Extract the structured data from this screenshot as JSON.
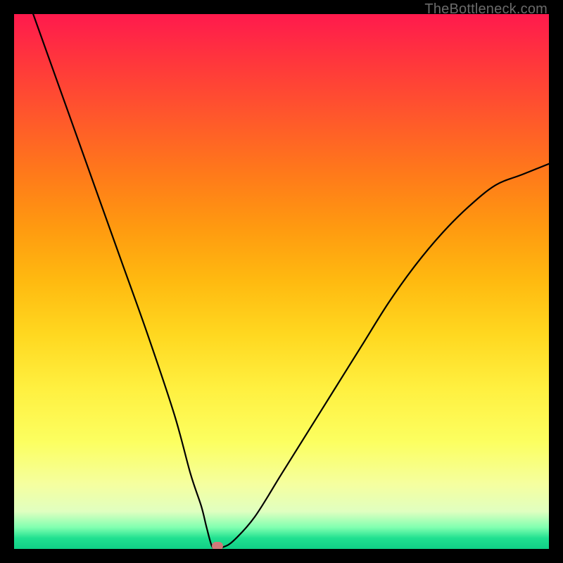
{
  "credit_text": "TheBottleneck.com",
  "colors": {
    "frame": "#000000",
    "curve": "#000000",
    "marker": "#cf7a7a"
  },
  "chart_data": {
    "type": "line",
    "title": "",
    "xlabel": "",
    "ylabel": "",
    "xlim": [
      0,
      100
    ],
    "ylim": [
      0,
      100
    ],
    "grid": false,
    "min_marker": {
      "x": 38,
      "y": 0
    },
    "series": [
      {
        "name": "bottleneck-curve",
        "x": [
          0,
          5,
          10,
          15,
          20,
          25,
          30,
          33,
          35,
          36,
          37,
          38,
          39,
          41,
          45,
          50,
          55,
          60,
          65,
          70,
          75,
          80,
          85,
          90,
          95,
          100
        ],
        "values": [
          110,
          96,
          82,
          68,
          54,
          40,
          25,
          14,
          8,
          4,
          0.5,
          0,
          0.3,
          1.5,
          6,
          14,
          22,
          30,
          38,
          46,
          53,
          59,
          64,
          68,
          70,
          72
        ]
      }
    ]
  }
}
